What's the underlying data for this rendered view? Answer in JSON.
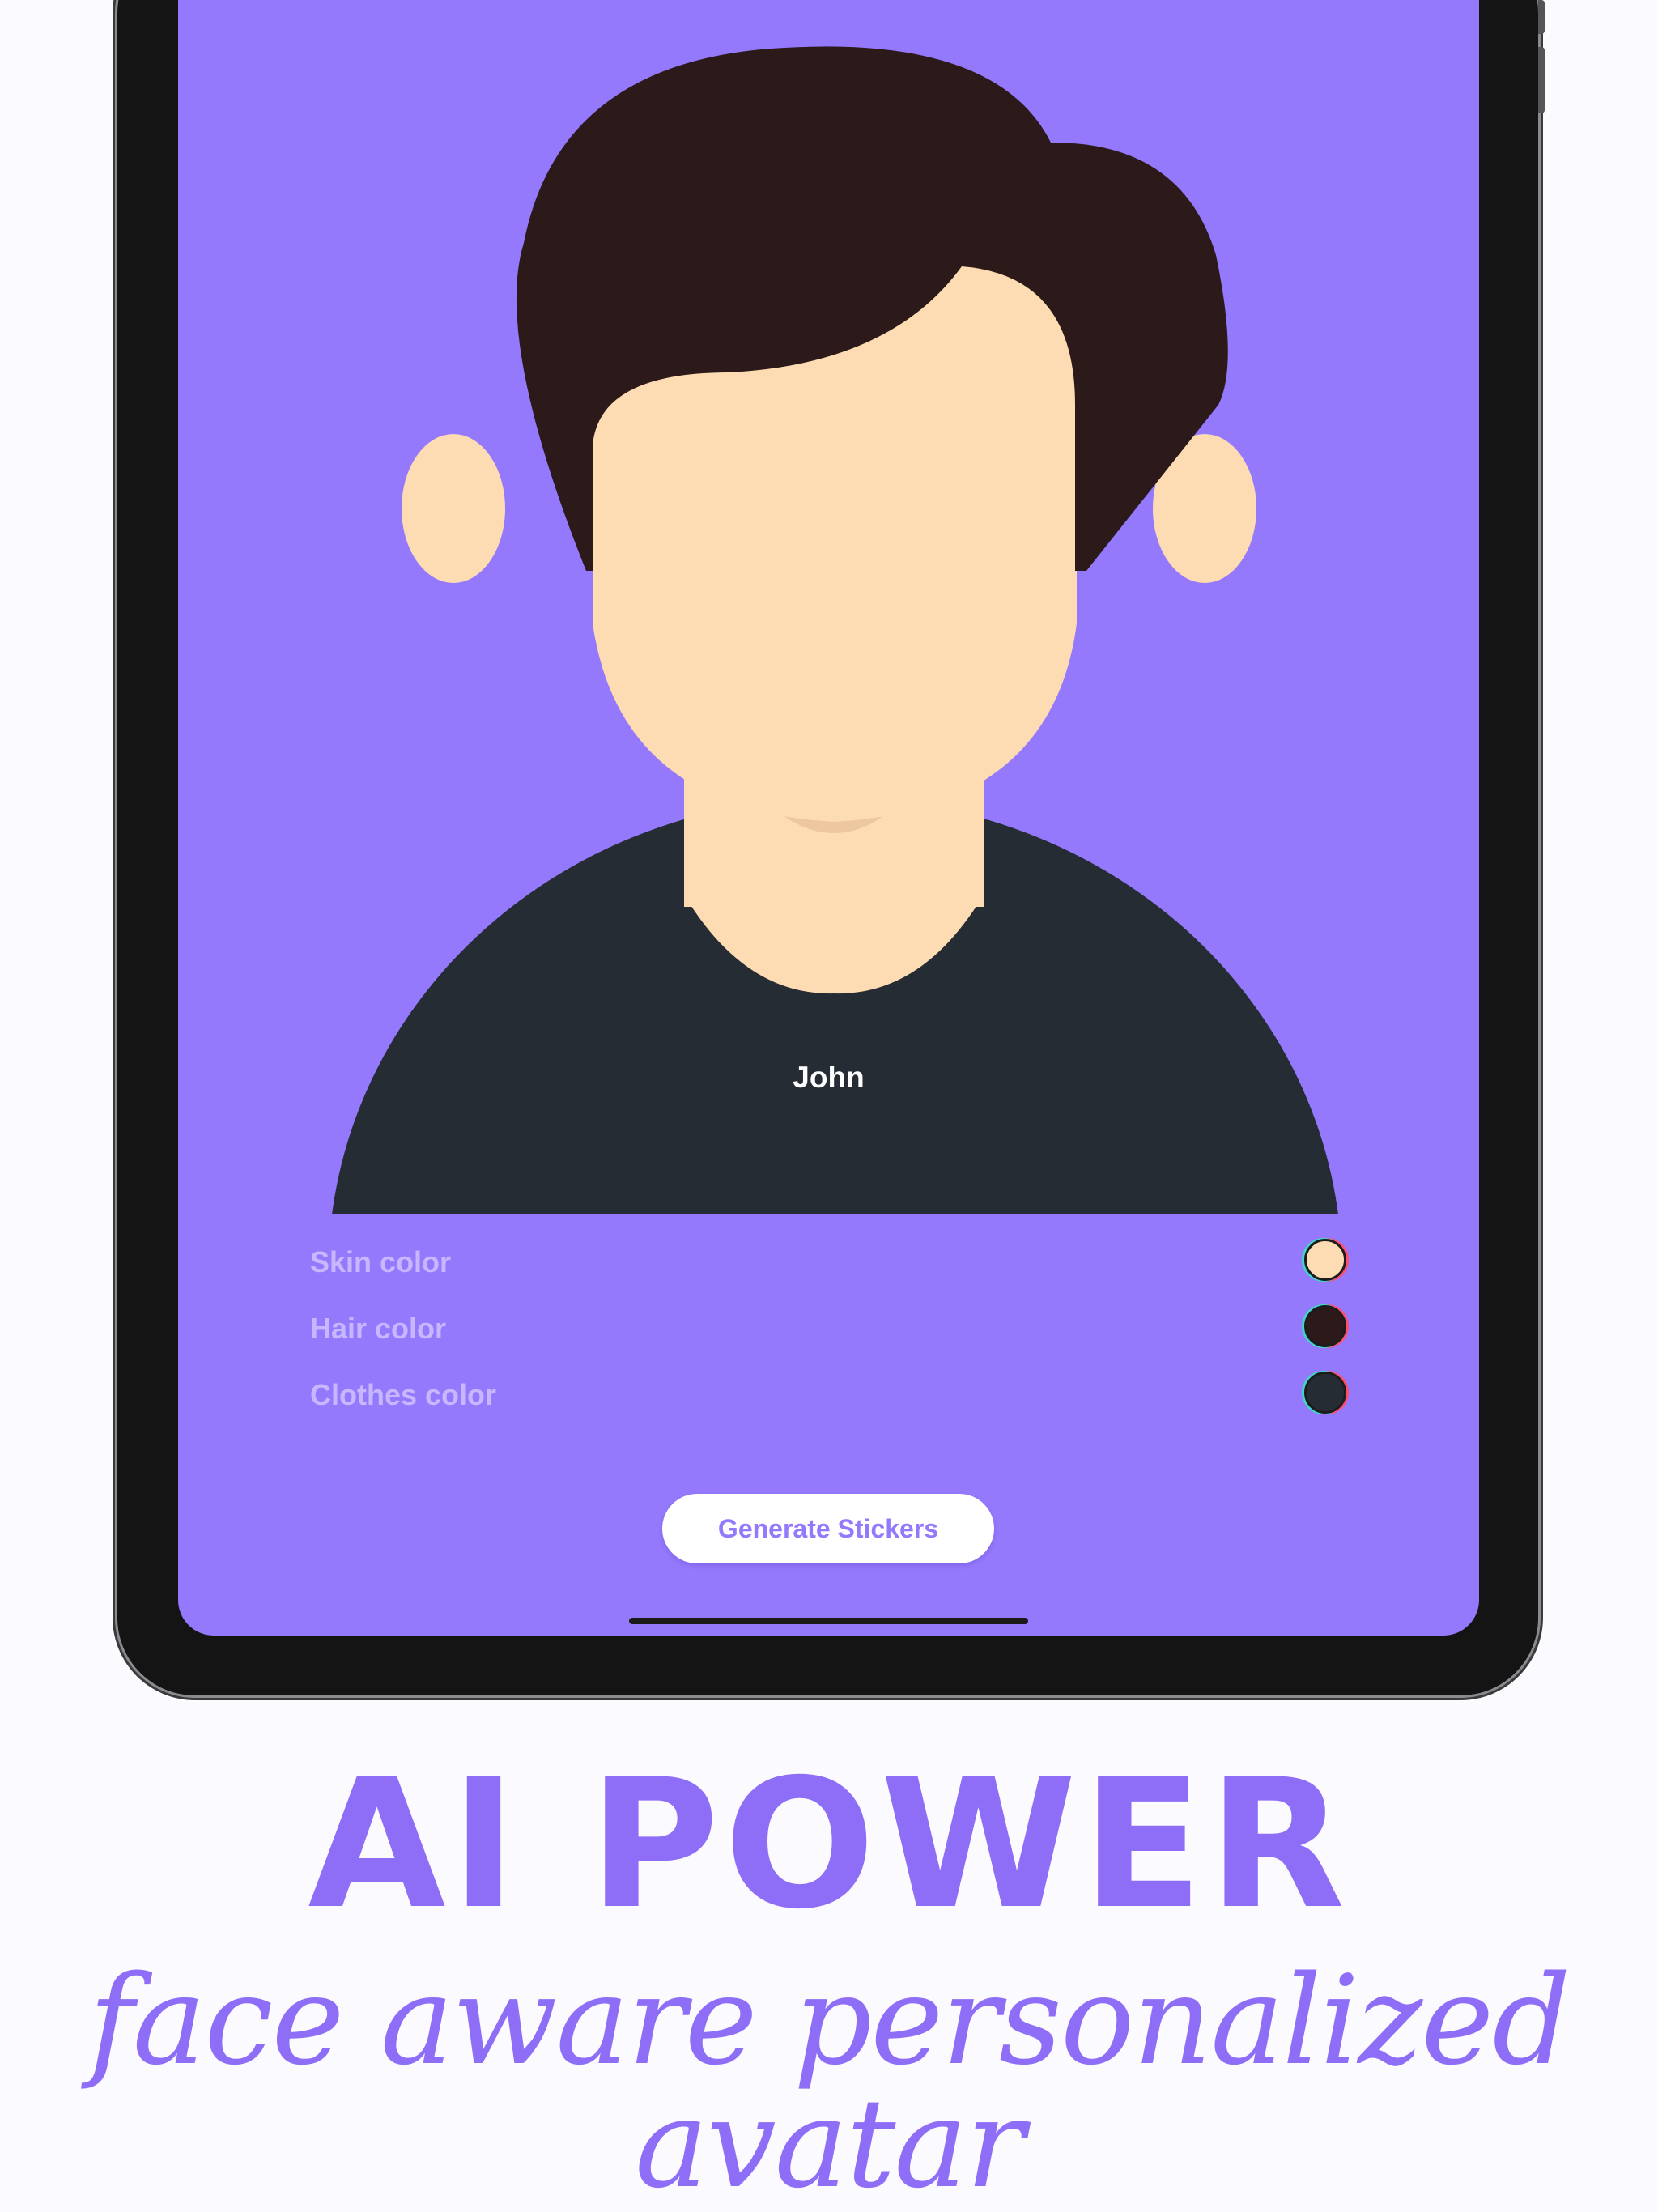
{
  "avatar": {
    "name": "John",
    "colors": {
      "background": "#9479fd",
      "skin": "#fddcb3",
      "skin_shadow": "#ecc79f",
      "hair": "#2c1a1a",
      "clothes": "#262c33"
    }
  },
  "options": [
    {
      "label": "Skin color",
      "swatch_color": "#fddcb3"
    },
    {
      "label": "Hair color",
      "swatch_color": "#2c1a1a"
    },
    {
      "label": "Clothes color",
      "swatch_color": "#262c33"
    }
  ],
  "actions": {
    "generate_label": "Generate Stickers"
  },
  "promo": {
    "headline": "AI POWER",
    "tagline": "face aware personalized avatar",
    "accent_color": "#8f6ef7"
  }
}
